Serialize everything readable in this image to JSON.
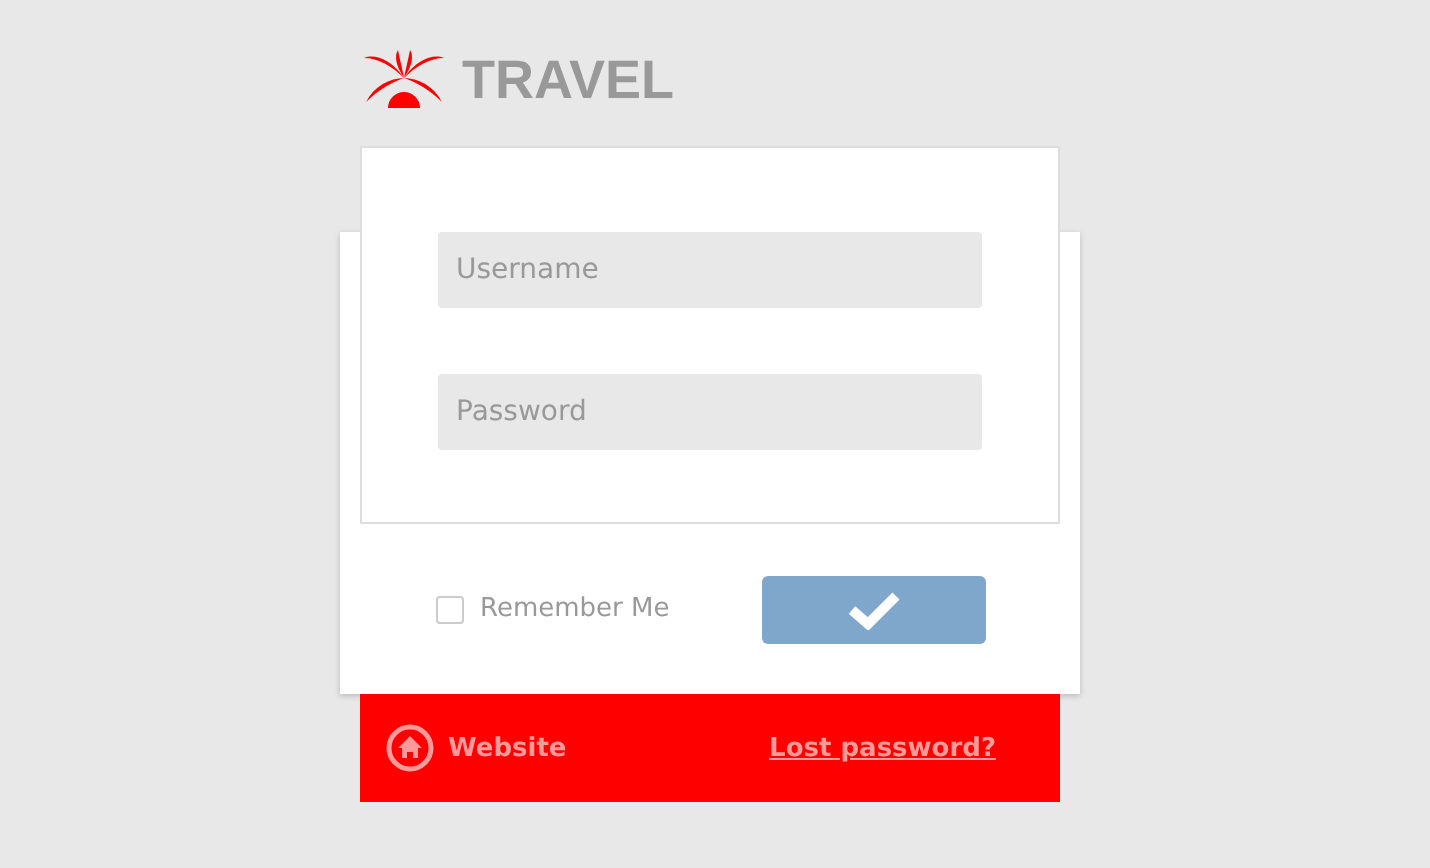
{
  "brand": {
    "name": "TRAVEL"
  },
  "fields": [
    {
      "placeholder": "Username"
    },
    {
      "placeholder": "Password"
    }
  ],
  "remember": {
    "label": "Remember Me",
    "checked": false
  },
  "footer": {
    "website": "Website",
    "lost_password": "Lost password?"
  }
}
